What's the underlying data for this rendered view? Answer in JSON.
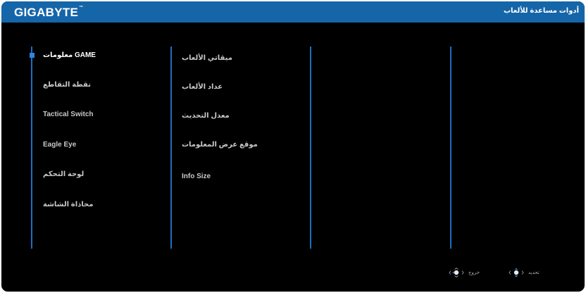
{
  "header": {
    "brand": "GIGABYTE",
    "brand_mark": "™",
    "title": "أدوات مساعدة للألعاب"
  },
  "main_menu": {
    "items": [
      {
        "label": "معلومات GAME",
        "active": true
      },
      {
        "label": "نقطة التقاطع",
        "active": false
      },
      {
        "label": "Tactical Switch",
        "active": false
      },
      {
        "label": "Eagle Eye",
        "active": false
      },
      {
        "label": "لوحة التحكم",
        "active": false
      },
      {
        "label": "محاذاة الشاشة",
        "active": false
      }
    ]
  },
  "sub_menu": {
    "items": [
      {
        "label": "ميقاتي الألعاب"
      },
      {
        "label": "عداد الألعاب"
      },
      {
        "label": "معدل التحديث"
      },
      {
        "label": "موقع عرض المعلومات"
      },
      {
        "label": "Info Size"
      }
    ]
  },
  "footer": {
    "exit_label": "خروج",
    "select_label": "تحديد",
    "exit_icon": "joystick-left-icon",
    "select_icon": "joystick-up-down-icon"
  },
  "colors": {
    "header_bg": "#1565a9",
    "divider": "#1f6dbf",
    "selection": "#2d86e0",
    "background": "#000000"
  }
}
